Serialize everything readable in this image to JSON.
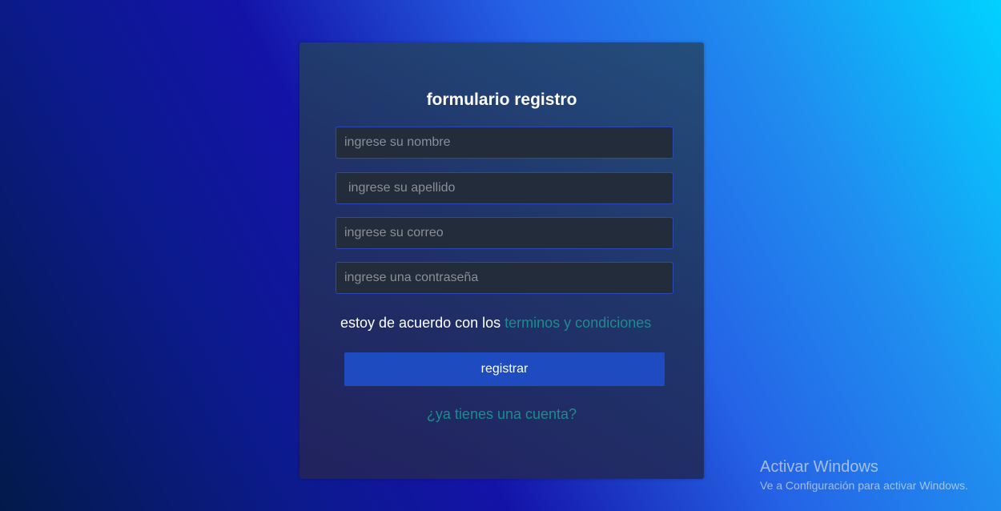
{
  "form": {
    "title": "formulario registro",
    "fields": {
      "nombre_placeholder": "ingrese su nombre",
      "apellido_placeholder": "ingrese su apellido",
      "correo_placeholder": "ingrese su correo",
      "password_placeholder": "ingrese una contraseña"
    },
    "terms_text": "estoy de acuerdo con los",
    "terms_link": "terminos y condiciones",
    "submit_label": "registrar",
    "login_link": "¿ya tienes una cuenta?"
  },
  "windows_watermark": {
    "title": "Activar Windows",
    "subtitle": "Ve a Configuración para activar Windows."
  },
  "colors": {
    "link": "#1c8c8c",
    "button": "#1e4bbf",
    "field_border": "#2c47b4"
  }
}
